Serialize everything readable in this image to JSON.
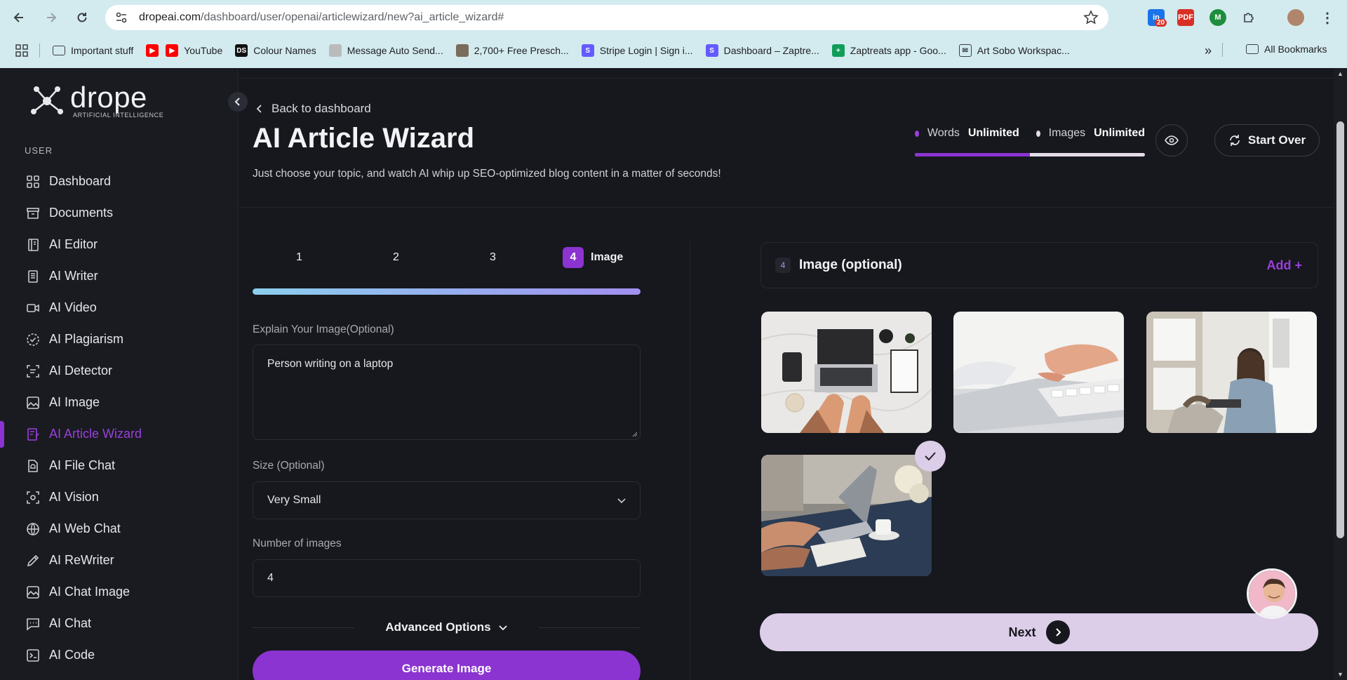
{
  "browser": {
    "url_host": "dropeai.com",
    "url_path": "/dashboard/user/openai/articlewizard/new?ai_article_wizard#",
    "ext_badge": "20",
    "bookmarks": [
      {
        "label": "Important stuff",
        "icon": "folder-icon"
      },
      {
        "label": "",
        "icon": "youtube-red-icon"
      },
      {
        "label": "YouTube",
        "icon": "youtube-icon"
      },
      {
        "label": "Colour Names",
        "icon": "ds-icon"
      },
      {
        "label": "Message Auto Send...",
        "icon": "message-icon"
      },
      {
        "label": "2,700+ Free Presch...",
        "icon": "photo-icon"
      },
      {
        "label": "Stripe Login | Sign i...",
        "icon": "stripe-icon"
      },
      {
        "label": "Dashboard – Zaptre...",
        "icon": "stripe-icon"
      },
      {
        "label": "Zaptreats app - Goo...",
        "icon": "sheets-icon"
      },
      {
        "label": "Art Sobo Workspac...",
        "icon": "mail-icon"
      }
    ],
    "all_bookmarks": "All Bookmarks"
  },
  "sidebar": {
    "brand_name": "drope",
    "brand_sub": "ARTIFICIAL INTELLIGENCE",
    "section": "USER",
    "items": [
      {
        "label": "Dashboard",
        "icon": "grid-icon"
      },
      {
        "label": "Documents",
        "icon": "archive-icon"
      },
      {
        "label": "AI Editor",
        "icon": "book-icon"
      },
      {
        "label": "AI Writer",
        "icon": "document-icon"
      },
      {
        "label": "AI Video",
        "icon": "video-icon"
      },
      {
        "label": "AI Plagiarism",
        "icon": "check-circle-icon"
      },
      {
        "label": "AI Detector",
        "icon": "scan-icon"
      },
      {
        "label": "AI Image",
        "icon": "image-icon"
      },
      {
        "label": "AI Article Wizard",
        "icon": "wizard-icon"
      },
      {
        "label": "AI File Chat",
        "icon": "file-chat-icon"
      },
      {
        "label": "AI Vision",
        "icon": "vision-icon"
      },
      {
        "label": "AI Web Chat",
        "icon": "globe-icon"
      },
      {
        "label": "AI ReWriter",
        "icon": "pen-icon"
      },
      {
        "label": "AI Chat Image",
        "icon": "chat-image-icon"
      },
      {
        "label": "AI Chat",
        "icon": "chat-icon"
      },
      {
        "label": "AI Code",
        "icon": "terminal-icon"
      }
    ],
    "active_index": 8
  },
  "header": {
    "back": "Back to dashboard",
    "title": "AI Article Wizard",
    "subtitle": "Just choose your topic, and watch AI whip up SEO-optimized blog content in a matter of seconds!",
    "words_label": "Words",
    "words_value": "Unlimited",
    "images_label": "Images",
    "images_value": "Unlimited",
    "credit_fill": 0.5,
    "start_over": "Start Over",
    "colors": {
      "words_dot": "#9b3fdb",
      "images_dot": "#e4dce9",
      "accent": "#8b34d1"
    }
  },
  "wizard": {
    "steps": [
      "1",
      "2",
      "3",
      "4"
    ],
    "active_step_label": "Image",
    "explain_label": "Explain Your Image(Optional)",
    "explain_value": "Person writing on a laptop",
    "size_label": "Size (Optional)",
    "size_value": "Very Small",
    "count_label": "Number of images",
    "count_value": "4",
    "advanced": "Advanced Options",
    "generate": "Generate Image"
  },
  "images_panel": {
    "badge": "4",
    "title": "Image (optional)",
    "add": "Add +",
    "selected_index": 3,
    "next": "Next"
  }
}
